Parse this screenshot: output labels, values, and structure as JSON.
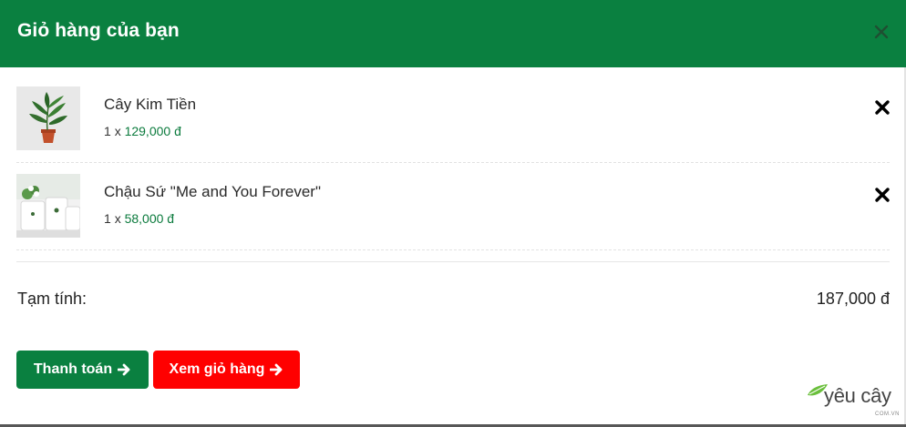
{
  "header": {
    "title": "Giỏ hàng của bạn"
  },
  "items": [
    {
      "name": "Cây Kim Tiền",
      "quantity": "1",
      "multiplier": "x",
      "price": "129,000 đ"
    },
    {
      "name": "Chậu Sứ \"Me and You Forever\"",
      "quantity": "1",
      "multiplier": "x",
      "price": "58,000 đ"
    }
  ],
  "subtotal": {
    "label": "Tạm tính:",
    "value": "187,000 đ"
  },
  "buttons": {
    "checkout": "Thanh toán",
    "view_cart": "Xem giỏ hàng"
  },
  "logo": {
    "text": "yêu cây",
    "sub": "COM.VN"
  },
  "colors": {
    "header": "#0a8040",
    "checkout_button": "#0a8040",
    "view_cart_button": "#ff0000",
    "price": "#0a7a3c"
  },
  "icons": {
    "close": "close-icon",
    "remove": "remove-icon",
    "arrow": "arrow-right-icon",
    "leaf": "leaf-icon"
  }
}
